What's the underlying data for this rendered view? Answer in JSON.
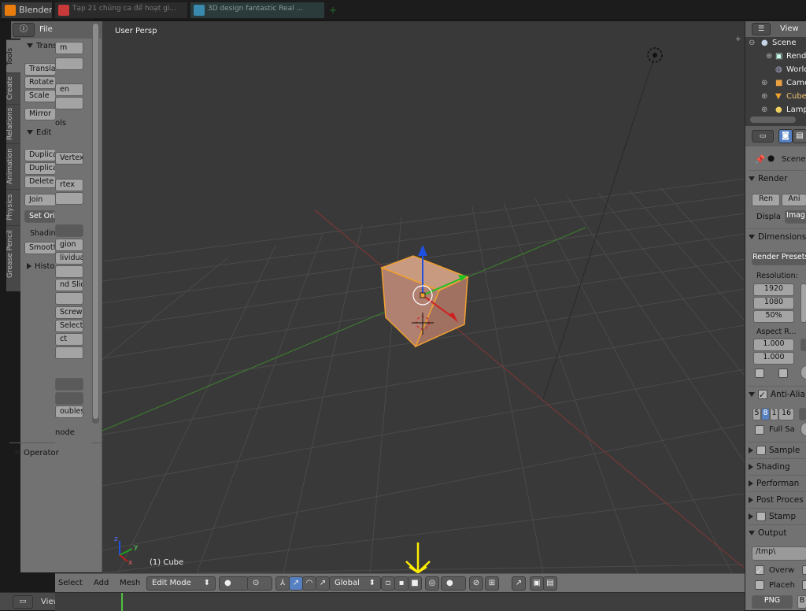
{
  "window": {
    "tabs": [
      {
        "label": "Blender"
      },
      {
        "label": "Tạp 21 chủng ca để hoạt gì..."
      },
      {
        "label": "3D design fantastic Real ..."
      }
    ]
  },
  "viewport": {
    "view_label": "User Persp",
    "object_label": "(1) Cube"
  },
  "side_tabs": [
    "Tools",
    "Create",
    "Relations",
    "Animation",
    "Physics",
    "Grease Pencil"
  ],
  "tool_shelf": {
    "file_menu": "File",
    "transform_header": "Trans",
    "transform_buttons": [
      "Transla",
      "Rotate",
      "Scale"
    ],
    "mirror_button": "Mirror",
    "edit_header": "Edit",
    "edit_buttons": [
      "Duplica",
      "Duplica",
      "Delete"
    ],
    "join_button": "Join",
    "set_origin_button": "Set Ori",
    "shading_label": "Shading",
    "smooth_button": "Smooth",
    "history_header": "Histo",
    "operator_header": "Operator"
  },
  "shelf_behind": {
    "cut_labels": [
      "m",
      "Tools",
      "en",
      "ols",
      "Vertex",
      "rtex",
      "gion",
      "lividual",
      "nd Slide",
      "Screw",
      "Select",
      "ct",
      "oubles",
      "node"
    ]
  },
  "header": {
    "menu_select": "Select",
    "menu_add": "Add",
    "menu_mesh": "Mesh",
    "mode": "Edit Mode",
    "orientation": "Global"
  },
  "timeline": {
    "menu_view": "View"
  },
  "outliner": {
    "view_label": "View",
    "items": [
      "Scene",
      "Rende",
      "World",
      "Came",
      "Cube",
      "Lamp"
    ]
  },
  "properties": {
    "scene_label": "Scene",
    "render_header": "Render",
    "render_btn": "Ren",
    "anim_btn": "Ani",
    "display_label": "Displa",
    "image_btn": "Imag",
    "dimensions_header": "Dimensions",
    "render_presets": "Render Presets",
    "resolution_label": "Resolution:",
    "res_x": "1920",
    "res_y": "1080",
    "res_pct": "50%",
    "aspect_label": "Aspect R...",
    "aspect_x": "1.000",
    "aspect_y": "1.000",
    "anti_alias_header": "Anti-Alia",
    "aa_samples": [
      "5",
      "8",
      "1",
      "16"
    ],
    "full_sample": "Full Sa",
    "sampled_header": "Sample",
    "shading_header": "Shading",
    "performance_header": "Performan",
    "post_processing_header": "Post Proces",
    "stamp_header": "Stamp",
    "output_header": "Output",
    "output_path": "/tmp\\",
    "overwrite_label": "Overw",
    "placeholder_label": "Placeh",
    "file_format": "PNG",
    "bw_label": "B"
  },
  "colors": {
    "selection_orange": "#f0a030",
    "x_axis": "#b03030",
    "y_axis": "#30a030",
    "z_axis": "#2050e0",
    "annotation_arrow": "#ffee00"
  }
}
